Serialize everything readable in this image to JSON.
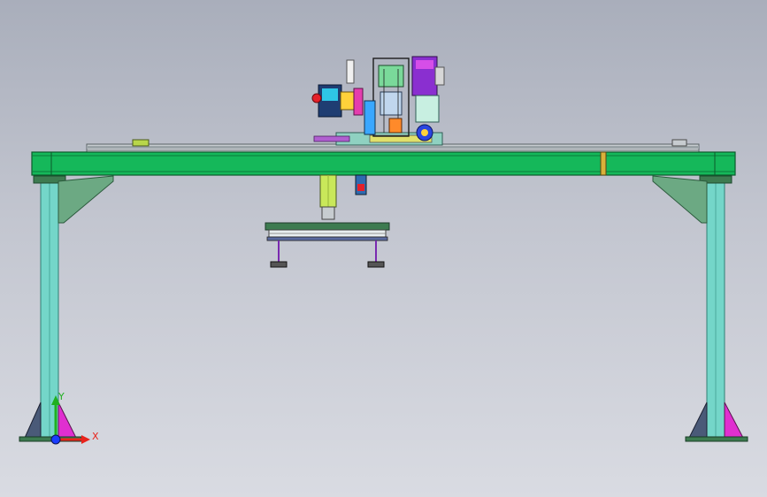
{
  "axis_triad": {
    "x_label": "X",
    "y_label": "Y",
    "x_color": "#e8231c",
    "y_color": "#1fb020",
    "origin_color": "#1a3cff"
  },
  "colors": {
    "beam_green": "#15b85a",
    "beam_dark": "#0b7a3a",
    "column_cyan": "#74d6c9",
    "column_edge": "#2f7f74",
    "brace_green": "#6ca983",
    "base_plate": "#3d7b50",
    "gusset_magenta": "#e02fd0",
    "gusset_dark": "#4a5a78",
    "rail_gray": "#9aa3a7"
  }
}
